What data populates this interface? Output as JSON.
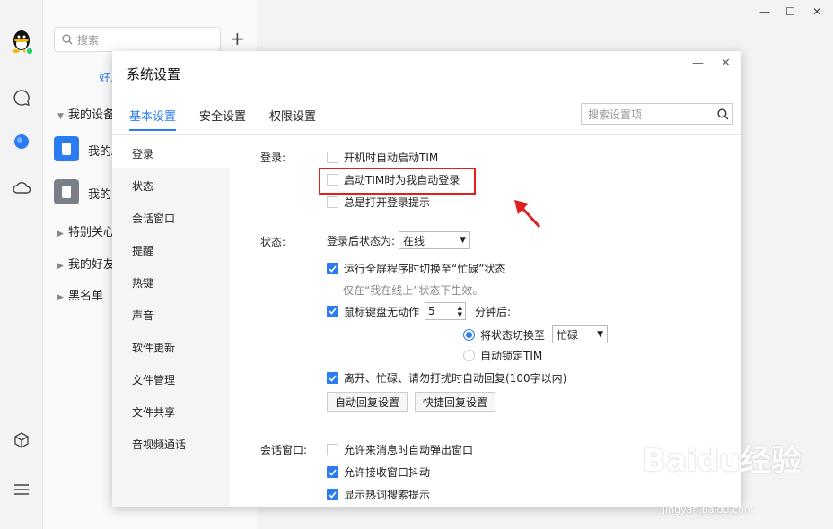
{
  "contacts": {
    "search_placeholder": "搜索",
    "tab_friends": "好友",
    "groups": [
      {
        "label": "我的设备"
      },
      {
        "label": "特别关心"
      },
      {
        "label": "我的好友"
      },
      {
        "label": "黑名单"
      }
    ],
    "devices": [
      {
        "label": "我的Android手机"
      },
      {
        "label": "我的iPad"
      }
    ]
  },
  "dialog": {
    "title": "系统设置",
    "tabs": [
      "基本设置",
      "安全设置",
      "权限设置"
    ],
    "search_placeholder": "搜索设置项",
    "nav": [
      "登录",
      "状态",
      "会话窗口",
      "提醒",
      "热键",
      "声音",
      "软件更新",
      "文件管理",
      "文件共享",
      "音视频通话"
    ],
    "login": {
      "label": "登录:",
      "options": [
        {
          "text": "开机时自动启动TIM",
          "checked": false
        },
        {
          "text": "启动TIM时为我自动登录",
          "checked": false
        },
        {
          "text": "总是打开登录提示",
          "checked": false
        }
      ]
    },
    "status": {
      "label": "状态:",
      "after_login_label": "登录后状态为:",
      "after_login_value": "在线",
      "fullscreen_text": "运行全屏程序时切换至“忙碌”状态",
      "fullscreen_hint": "仅在“我在线上”状态下生效。",
      "idle_text": "鼠标键盘无动作",
      "idle_minutes": "5",
      "idle_suffix": "分钟后:",
      "switch_to_label": "将状态切换至",
      "switch_to_value": "忙碌",
      "auto_lock_label": "自动锁定TIM",
      "auto_reply_text": "离开、忙碌、请勿打扰时自动回复(100字以内)",
      "auto_reply_btn": "自动回复设置",
      "quick_reply_btn": "快捷回复设置"
    },
    "session": {
      "label": "会话窗口:",
      "options": [
        {
          "text": "允许来消息时自动弹出窗口",
          "checked": false
        },
        {
          "text": "允许接收窗口抖动",
          "checked": true
        },
        {
          "text": "显示热词搜索提示",
          "checked": true
        }
      ]
    }
  },
  "watermark": {
    "brand": "Baidu经验",
    "url": "jingyan.baidu.com"
  },
  "colors": {
    "accent": "#2a7cf0",
    "highlight": "#e02020"
  }
}
